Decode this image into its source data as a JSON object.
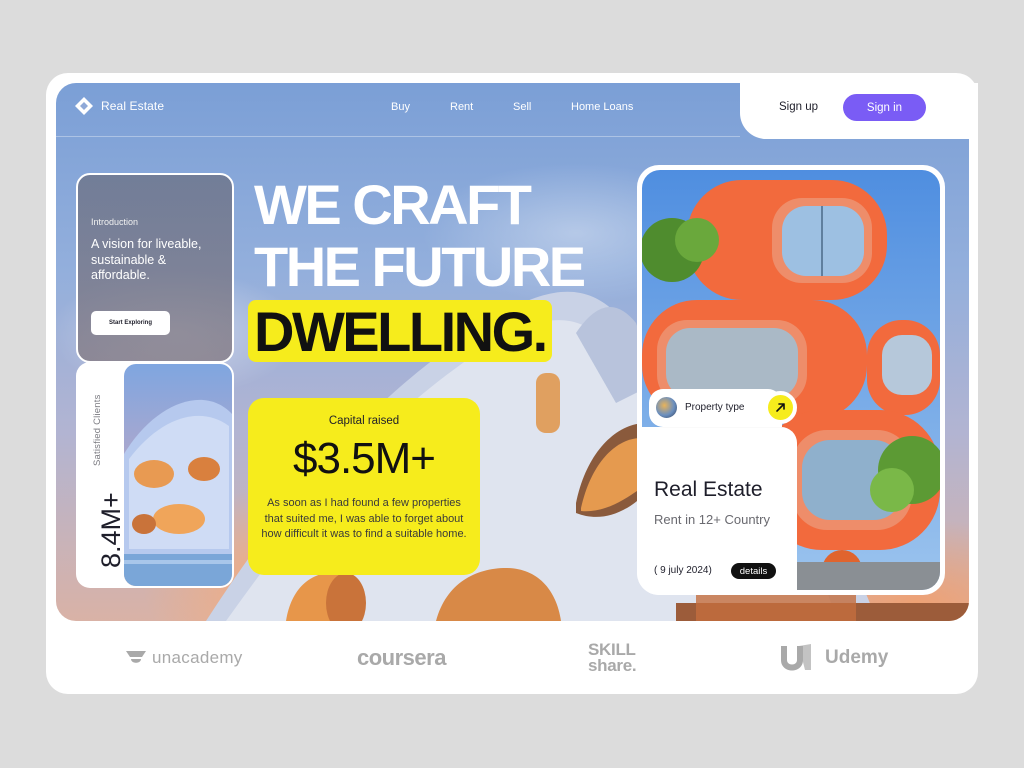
{
  "nav": {
    "brand": "Real Estate",
    "links": [
      "Buy",
      "Rent",
      "Sell",
      "Home Loans"
    ],
    "sign_up": "Sign up",
    "sign_in": "Sign in"
  },
  "intro_card": {
    "tag": "Introduction",
    "text": "A vision for liveable, sustainable & affordable.",
    "button": "Start Exploring"
  },
  "stats": {
    "value": "8.4M+",
    "label": "Satisfied Clients"
  },
  "headline": {
    "line1": "WE CRAFT",
    "line2": "THE FUTURE",
    "highlight": "DWELLING."
  },
  "capital": {
    "label": "Capital raised",
    "value": "$3.5M+",
    "text": "As soon as I had found a few properties that suited me, I was able to forget about how difficult it was to find a suitable home."
  },
  "property": {
    "type_label": "Property type",
    "title": "Real Estate",
    "subtitle": "Rent in 12+ Country",
    "date": "( 9 july 2024)",
    "details": "details"
  },
  "brands": {
    "unacademy": "unacademy",
    "coursera": "coursera",
    "skillshare_line1": "SKILL",
    "skillshare_line2": "share.",
    "udemy": "Udemy"
  },
  "colors": {
    "accent_purple": "#7a5cf5",
    "accent_yellow": "#f6ec1c",
    "dark": "#1e1e2a"
  }
}
